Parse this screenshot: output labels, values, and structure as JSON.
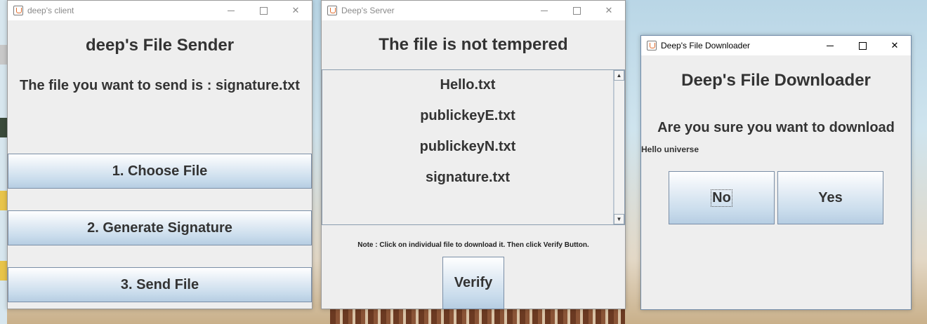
{
  "client_window": {
    "title": "deep's client",
    "heading": "deep's File Sender",
    "subheading": "The file you want to send is : signature.txt",
    "buttons": [
      "1. Choose File",
      "2. Generate Signature",
      "3. Send File"
    ]
  },
  "server_window": {
    "title": "Deep's Server",
    "heading": "The file is not tempered",
    "files": [
      "Hello.txt",
      "publickeyE.txt",
      "publickeyN.txt",
      "signature.txt"
    ],
    "note": "Note : Click on individual file to download it. Then click Verify Button.",
    "verify_label": "Verify"
  },
  "downloader_window": {
    "title": "Deep's File Downloader",
    "heading": "Deep's File Downloader",
    "question": "Are you sure you want to download",
    "file_content": "Hello universe",
    "no_label": "No",
    "yes_label": "Yes"
  },
  "colors": {
    "button_gradient_top": "#ffffff",
    "button_gradient_bottom": "#b6cde2",
    "panel_bg": "#eeeeee",
    "text": "#333333"
  },
  "icons": [
    "java-app-icon",
    "minimize-icon",
    "maximize-icon",
    "close-icon",
    "scroll-up-arrow-icon",
    "scroll-down-arrow-icon"
  ]
}
